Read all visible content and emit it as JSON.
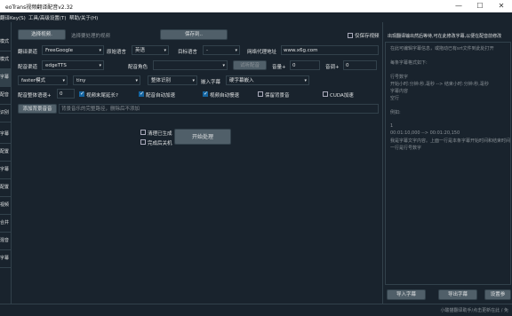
{
  "window": {
    "title": "eoTrans视频翻译配音v2.32",
    "min_icon": "minimize-icon",
    "max_icon": "maximize-icon",
    "close_icon": "close-icon"
  },
  "menu": [
    "翻译Key(S)",
    "工具/高级设置(T)",
    "帮助/关于(H)"
  ],
  "sidebar": [
    "模式",
    "模式",
    "字幕",
    "配音",
    "识别",
    "字幕",
    "配置",
    "字幕",
    "配置",
    "视频",
    "合并",
    "混音",
    "字幕"
  ],
  "toolbar": {
    "select_video": "选择视频.",
    "select_video_hint": "选择要处理的视频",
    "save_to": "保存到..",
    "only_save_video": "仅保存视频"
  },
  "row_translate": {
    "label": "翻译渠道",
    "channel": "FreeGoogle",
    "source_label": "原始语言",
    "source_value": "英语",
    "target_label": "目标语言",
    "target_value": "-",
    "proxy_label": "网络代理地址",
    "proxy_value": "www.x6g.com"
  },
  "row_dubbing": {
    "label": "配音渠道",
    "channel": "edgeTTS",
    "role_label": "配音角色",
    "role_value": "",
    "listen_button": "试听配音",
    "volume_label": "音量+",
    "volume_value": "0",
    "pitch_label": "音调+",
    "pitch_value": "0"
  },
  "row_model": {
    "mode": "faster模式",
    "model": "tiny",
    "split_label": "整体识别",
    "embed_label": "嵌入字幕",
    "embed_value": "硬字幕嵌入"
  },
  "row_options": {
    "speed_label": "配音整体语速+",
    "speed_value": "0",
    "video_end_extend": "视频末尾延长?",
    "auto_speed_voice": "配音自动加速",
    "auto_slow_video": "视频自动慢速",
    "keep_bg_music": "保留背景音",
    "cuda": "CUDA加速"
  },
  "row_bgm": {
    "add_button": "添加背景音音",
    "placeholder": "背景音乐的完整路径，删除后不添加"
  },
  "actions": {
    "clear_cache": "清理已生成",
    "shutdown_after": "完成后关机",
    "start_button": "开始处理"
  },
  "right_panel": {
    "header": "出现翻译输出然后等待,可在此修改字幕,以便在配音前修改",
    "lines": [
      "在此可编辑字幕信息，或拖动已有srt文件到此处打开",
      "",
      "每条字幕格式如下:",
      "",
      "行号数字",
      "开始小时:分钟:秒,毫秒 --> 结束小时:分钟:秒,毫秒",
      "字幕内容",
      "空行",
      "",
      "例如:",
      "",
      "1",
      "00:01:10,000 --> 00:01:20,150",
      "我是字幕文字内容。上面一行是本条字幕开始时间和结束时间",
      "一行是行号数字"
    ],
    "import_button": "导入字幕",
    "export_button": "导出字幕",
    "set_button": "设置参"
  },
  "status": {
    "right_text": "小酸猫翻译助手/点击更新在此 / 免"
  }
}
